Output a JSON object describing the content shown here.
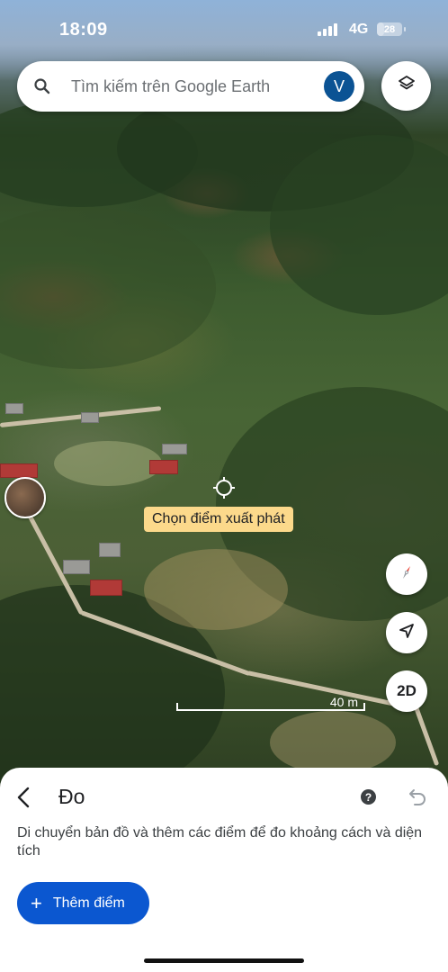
{
  "status_bar": {
    "time": "18:09",
    "network": "4G",
    "battery": "28",
    "battery_level": 0.28
  },
  "search": {
    "placeholder": "Tìm kiếm trên Google Earth",
    "avatar_letter": "V"
  },
  "map": {
    "start_point_tooltip": "Chọn điểm xuất phát",
    "view_mode_button": "2D",
    "scale_label": "40 m"
  },
  "sheet": {
    "title": "Đo",
    "description": "Di chuyển bản đồ và thêm các điểm để đo khoảng cách và diện tích",
    "add_point_label": "Thêm điểm",
    "add_point_icon": "plus-icon"
  },
  "colors": {
    "accent": "#0b57d0",
    "avatar": "#0b5394",
    "tooltip": "#fcd98b",
    "compass_red": "#ea4335"
  },
  "icons": [
    "search-icon",
    "layers-icon",
    "compass-icon",
    "navigation-arrow-icon",
    "back-arrow-icon",
    "help-icon",
    "undo-icon",
    "crosshair-icon"
  ]
}
